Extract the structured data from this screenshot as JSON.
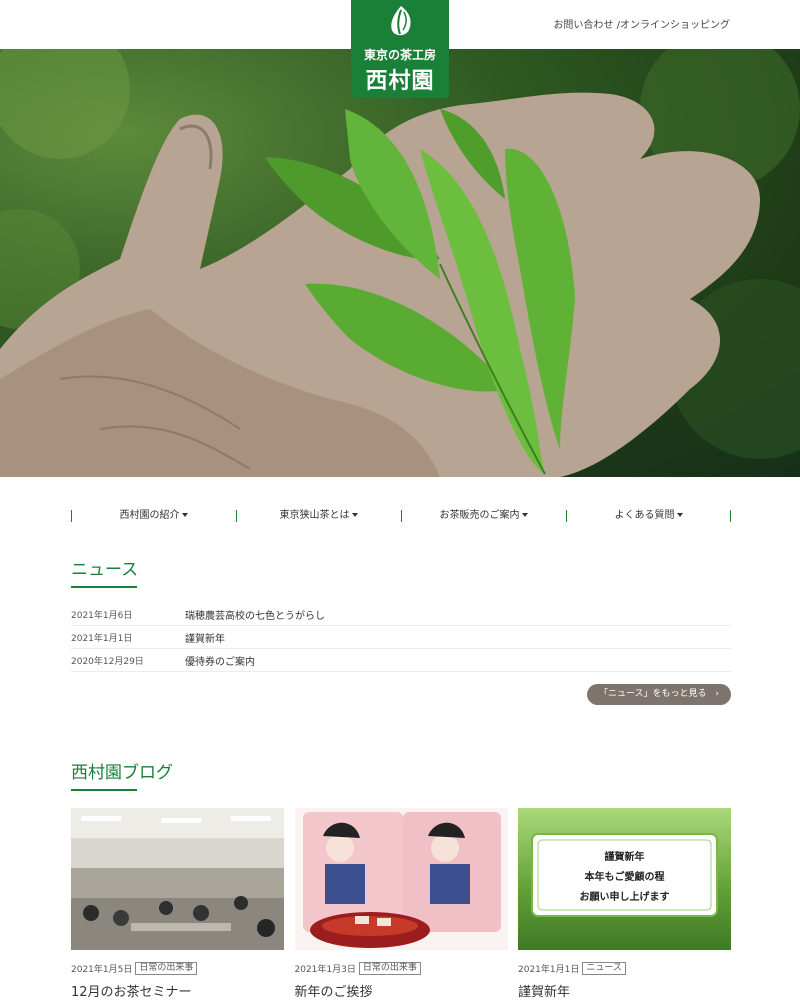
{
  "header": {
    "contact": "お問い合わせ",
    "shop": "/オンラインショッピング",
    "logo_line1": "東京の茶工房",
    "logo_line2": "西村園"
  },
  "nav": [
    {
      "label": "西村園の紹介"
    },
    {
      "label": "東京狭山茶とは"
    },
    {
      "label": "お茶販売のご案内"
    },
    {
      "label": "よくある質問"
    }
  ],
  "news": {
    "title": "ニュース",
    "items": [
      {
        "date": "2021年1月6日",
        "text": "瑞穂農芸高校の七色とうがらし"
      },
      {
        "date": "2021年1月1日",
        "text": "謹賀新年"
      },
      {
        "date": "2020年12月29日",
        "text": "優待券のご案内"
      }
    ],
    "more": "「ニュース」をもっと見る"
  },
  "blog": {
    "title": "西村園ブログ",
    "posts": [
      {
        "date": "2021年1月5日",
        "tag": "日常の出来事",
        "title": "12月のお茶セミナー"
      },
      {
        "date": "2021年1月3日",
        "tag": "日常の出来事",
        "title": "新年のご挨拶"
      },
      {
        "date": "2021年1月1日",
        "tag": "ニュース",
        "title": "謹賀新年"
      }
    ],
    "card3_text": [
      "謹賀新年",
      "本年もご愛顧の程",
      "お願い申し上げます"
    ]
  },
  "colors": {
    "brand": "#1a7f37",
    "button": "#7d746e"
  }
}
